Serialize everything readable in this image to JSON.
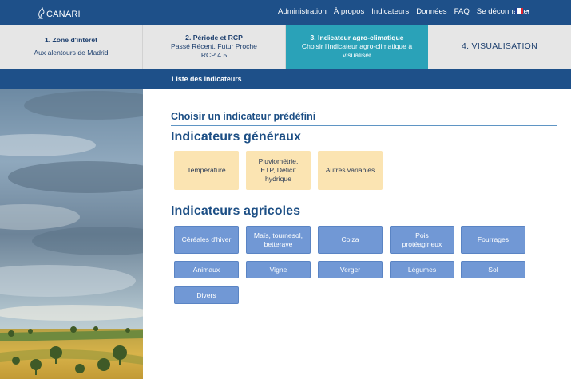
{
  "navbar": {
    "logo_text": "CANARI",
    "links": [
      "Administration",
      "À propos",
      "Indicateurs",
      "Données",
      "FAQ",
      "Se déconnecter"
    ],
    "flag_colors": [
      "#1f3f94",
      "#ffffff",
      "#e0222e"
    ]
  },
  "steps": [
    {
      "title": "1. Zone d'intérêt",
      "lines": [
        "Aux alentours de Madrid"
      ]
    },
    {
      "title": "2. Période et RCP",
      "lines": [
        "Passé Récent, Futur Proche",
        "RCP 4.5"
      ]
    },
    {
      "title": "3. Indicateur agro-climatique",
      "lines": [
        "Choisir l'indicateur agro-climatique à",
        "visualiser"
      ]
    },
    {
      "title": "4. VISUALISATION",
      "lines": []
    }
  ],
  "subnav": {
    "item": "Liste des indicateurs"
  },
  "main": {
    "section_title": "Choisir un indicateur prédéfini",
    "general_title": "Indicateurs généraux",
    "general_buttons": [
      [
        "Température"
      ],
      [
        "Pluviométrie,",
        "ETP, Deficit",
        "hydrique"
      ],
      [
        "Autres variables"
      ]
    ],
    "agri_title": "Indicateurs agricoles",
    "agri_buttons": [
      [
        "Céréales d'hiver"
      ],
      [
        "Maïs, tournesol,",
        "betterave"
      ],
      [
        "Colza"
      ],
      [
        "Pois",
        "protéagineux"
      ],
      [
        "Fourrages"
      ],
      [
        "Animaux"
      ],
      [
        "Vigne"
      ],
      [
        "Verger"
      ],
      [
        "Légumes"
      ],
      [
        "Sol"
      ],
      [
        "Divers"
      ]
    ]
  },
  "colors": {
    "navbar": "#1e5089",
    "active_step": "#2aa2b8",
    "general_button": "#fbe4b2",
    "agri_button": "#7198d5",
    "heading": "#1d4f85"
  }
}
